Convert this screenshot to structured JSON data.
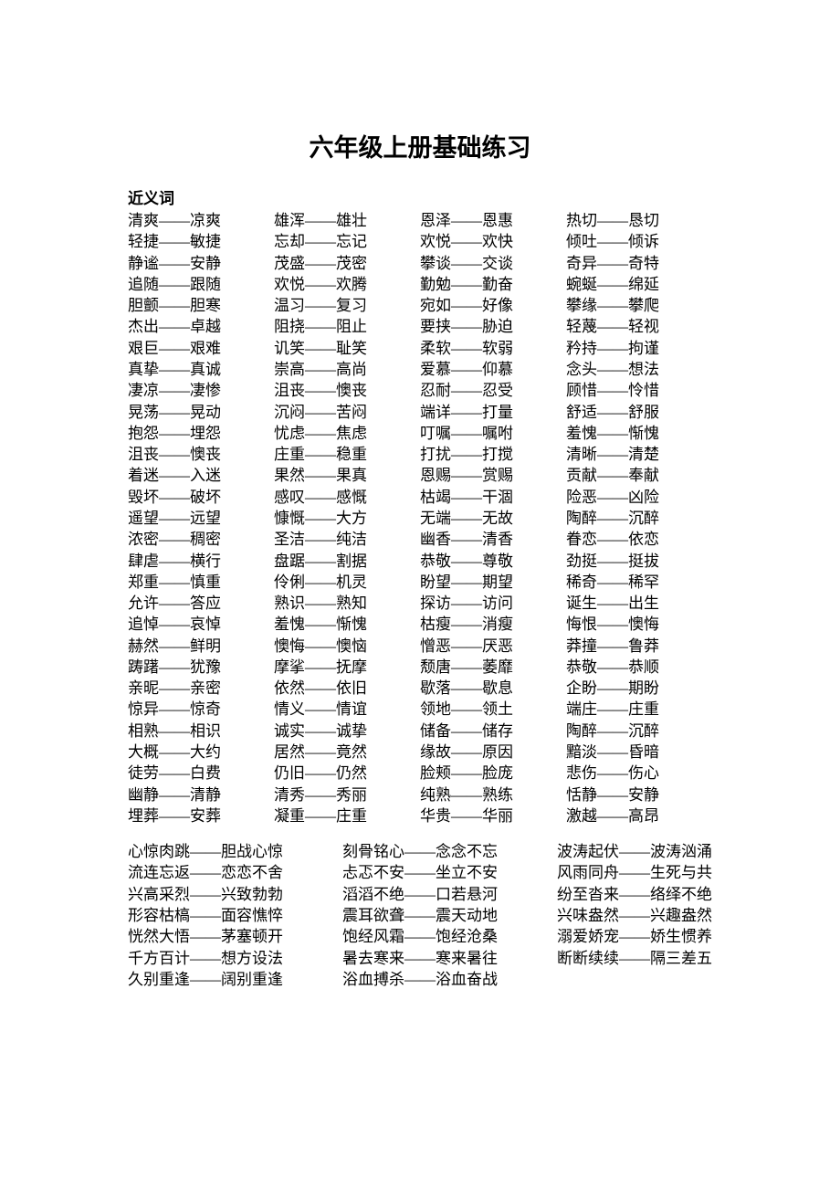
{
  "title": "六年级上册基础练习",
  "section_label": "近义词",
  "col1": [
    [
      "清爽",
      "凉爽"
    ],
    [
      "轻捷",
      "敏捷"
    ],
    [
      "静谧",
      "安静"
    ],
    [
      "追随",
      "跟随"
    ],
    [
      "胆颤",
      "胆寒"
    ],
    [
      "杰出",
      "卓越"
    ],
    [
      "艰巨",
      "艰难"
    ],
    [
      "真挚",
      "真诚"
    ],
    [
      "凄凉",
      "凄惨"
    ],
    [
      "晃荡",
      "晃动"
    ],
    [
      "抱怨",
      "埋怨"
    ],
    [
      "沮丧",
      "懊丧"
    ],
    [
      "着迷",
      "入迷"
    ],
    [
      "毁坏",
      "破坏"
    ],
    [
      "遥望",
      "远望"
    ],
    [
      "浓密",
      "稠密"
    ],
    [
      "肆虐",
      "横行"
    ],
    [
      "郑重",
      "慎重"
    ],
    [
      "允许",
      "答应"
    ],
    [
      "追悼",
      "哀悼"
    ],
    [
      "赫然",
      "鲜明"
    ],
    [
      "踌躇",
      "犹豫"
    ],
    [
      "亲昵",
      "亲密"
    ],
    [
      "惊异",
      "惊奇"
    ],
    [
      "相熟",
      "相识"
    ],
    [
      "大概",
      "大约"
    ],
    [
      "徒劳",
      "白费"
    ],
    [
      "幽静",
      "清静"
    ],
    [
      "埋葬",
      "安葬"
    ]
  ],
  "col2": [
    [
      "雄浑",
      "雄壮"
    ],
    [
      "忘却",
      "忘记"
    ],
    [
      "茂盛",
      "茂密"
    ],
    [
      "欢悦",
      "欢腾"
    ],
    [
      "温习",
      "复习"
    ],
    [
      "阻挠",
      "阻止"
    ],
    [
      "讥笑",
      "耻笑"
    ],
    [
      "崇高",
      "高尚"
    ],
    [
      "沮丧",
      "懊丧"
    ],
    [
      "沉闷",
      "苦闷"
    ],
    [
      "忧虑",
      "焦虑"
    ],
    [
      "庄重",
      "稳重"
    ],
    [
      "果然",
      "果真"
    ],
    [
      "感叹",
      "感慨"
    ],
    [
      "慷慨",
      "大方"
    ],
    [
      "圣洁",
      "纯洁"
    ],
    [
      "盘踞",
      "割据"
    ],
    [
      "伶俐",
      "机灵"
    ],
    [
      "熟识",
      "熟知"
    ],
    [
      "羞愧",
      "惭愧"
    ],
    [
      "懊悔",
      "懊恼"
    ],
    [
      "摩挲",
      "抚摩"
    ],
    [
      "依然",
      "依旧"
    ],
    [
      "情义",
      "情谊"
    ],
    [
      "诚实",
      "诚挚"
    ],
    [
      "居然",
      "竟然"
    ],
    [
      "仍旧",
      "仍然"
    ],
    [
      "清秀",
      "秀丽"
    ],
    [
      "凝重",
      "庄重"
    ]
  ],
  "col3": [
    [
      "恩泽",
      "恩惠"
    ],
    [
      "欢悦",
      "欢快"
    ],
    [
      "攀谈",
      "交谈"
    ],
    [
      "勤勉",
      "勤奋"
    ],
    [
      "宛如",
      "好像"
    ],
    [
      "要挟",
      "胁迫"
    ],
    [
      "柔软",
      "软弱"
    ],
    [
      "爱慕",
      "仰慕"
    ],
    [
      "忍耐",
      "忍受"
    ],
    [
      "端详",
      "打量"
    ],
    [
      "叮嘱",
      "嘱咐"
    ],
    [
      "打扰",
      "打搅"
    ],
    [
      "恩赐",
      "赏赐"
    ],
    [
      "枯竭",
      "干涸"
    ],
    [
      "无端",
      "无故"
    ],
    [
      "幽香",
      "清香"
    ],
    [
      "恭敬",
      "尊敬"
    ],
    [
      "盼望",
      "期望"
    ],
    [
      "探访",
      "访问"
    ],
    [
      "枯瘦",
      "消瘦"
    ],
    [
      "憎恶",
      "厌恶"
    ],
    [
      "颓唐",
      "萎靡"
    ],
    [
      "歇落",
      "歇息"
    ],
    [
      "领地",
      "领土"
    ],
    [
      "储备",
      "储存"
    ],
    [
      "缘故",
      "原因"
    ],
    [
      "脸颊",
      "脸庞"
    ],
    [
      "纯熟",
      "熟练"
    ],
    [
      "华贵",
      "华丽"
    ]
  ],
  "col4": [
    [
      "热切",
      "恳切"
    ],
    [
      "倾吐",
      "倾诉"
    ],
    [
      "奇异",
      "奇特"
    ],
    [
      "蜿蜒",
      "绵延"
    ],
    [
      "攀缘",
      "攀爬"
    ],
    [
      "轻蔑",
      "轻视"
    ],
    [
      "矜持",
      "拘谨"
    ],
    [
      "念头",
      "想法"
    ],
    [
      "顾惜",
      "怜惜"
    ],
    [
      "舒适",
      "舒服"
    ],
    [
      "羞愧",
      "惭愧"
    ],
    [
      "清晰",
      "清楚"
    ],
    [
      "贡献",
      "奉献"
    ],
    [
      "险恶",
      "凶险"
    ],
    [
      "陶醉",
      "沉醉"
    ],
    [
      "眷恋",
      "依恋"
    ],
    [
      "劲挺",
      "挺拔"
    ],
    [
      "稀奇",
      "稀罕"
    ],
    [
      "诞生",
      "出生"
    ],
    [
      "悔恨",
      "懊悔"
    ],
    [
      "莽撞",
      "鲁莽"
    ],
    [
      "恭敬",
      "恭顺"
    ],
    [
      "企盼",
      "期盼"
    ],
    [
      "端庄",
      "庄重"
    ],
    [
      "陶醉",
      "沉醉"
    ],
    [
      "黯淡",
      "昏暗"
    ],
    [
      "悲伤",
      "伤心"
    ],
    [
      "恬静",
      "安静"
    ],
    [
      "激越",
      "高昂"
    ]
  ],
  "idioms_col1": [
    [
      "心惊肉跳",
      "胆战心惊"
    ],
    [
      "流连忘返",
      "恋恋不舍"
    ],
    [
      "兴高采烈",
      "兴致勃勃"
    ],
    [
      "形容枯槁",
      "面容憔悴"
    ],
    [
      "恍然大悟",
      "茅塞顿开"
    ],
    [
      "千方百计",
      "想方设法"
    ],
    [
      "久别重逢",
      "阔别重逢"
    ]
  ],
  "idioms_col2": [
    [
      "刻骨铭心",
      "念念不忘"
    ],
    [
      "忐忑不安",
      "坐立不安"
    ],
    [
      "滔滔不绝",
      "口若悬河"
    ],
    [
      "震耳欲聋",
      "震天动地"
    ],
    [
      "饱经风霜",
      "饱经沧桑"
    ],
    [
      "暑去寒来",
      "寒来暑往"
    ],
    [
      "浴血搏杀",
      "浴血奋战"
    ]
  ],
  "idioms_col3": [
    [
      "波涛起伏",
      "波涛汹涌"
    ],
    [
      "风雨同舟",
      "生死与共"
    ],
    [
      "纷至沓来",
      "络绎不绝"
    ],
    [
      "兴味盎然",
      "兴趣盎然"
    ],
    [
      "溺爱娇宠",
      "娇生惯养"
    ],
    [
      "断断续续",
      "隔三差五"
    ]
  ]
}
